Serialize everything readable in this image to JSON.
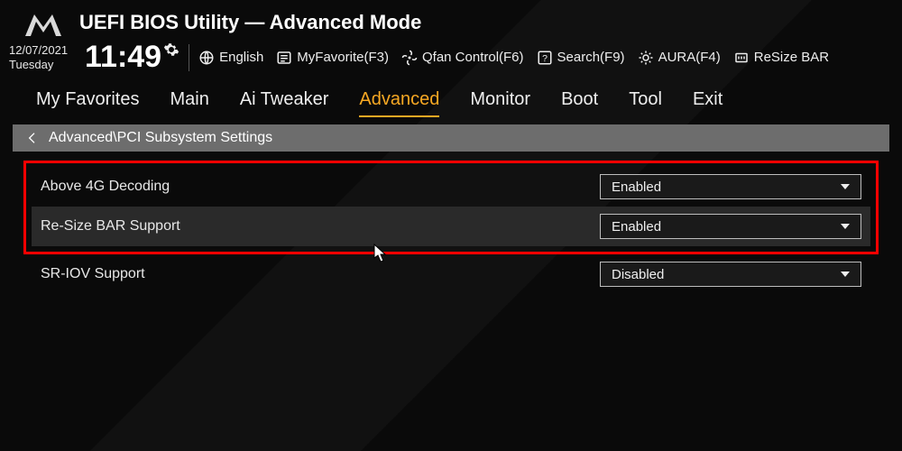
{
  "header": {
    "title": "UEFI BIOS Utility — Advanced Mode"
  },
  "datetime": {
    "date": "12/07/2021",
    "day": "Tuesday",
    "time": "11:49"
  },
  "topbar": {
    "language": "English",
    "myfavorite": "MyFavorite(F3)",
    "qfan": "Qfan Control(F6)",
    "search": "Search(F9)",
    "aura": "AURA(F4)",
    "resizebar": "ReSize BAR"
  },
  "tabs": [
    "My Favorites",
    "Main",
    "Ai Tweaker",
    "Advanced",
    "Monitor",
    "Boot",
    "Tool",
    "Exit"
  ],
  "active_tab": "Advanced",
  "breadcrumb": "Advanced\\PCI Subsystem Settings",
  "settings": [
    {
      "label": "Above 4G Decoding",
      "value": "Enabled",
      "highlighted": true
    },
    {
      "label": "Re-Size BAR Support",
      "value": "Enabled",
      "highlighted": true
    },
    {
      "label": "SR-IOV Support",
      "value": "Disabled",
      "highlighted": false
    }
  ]
}
